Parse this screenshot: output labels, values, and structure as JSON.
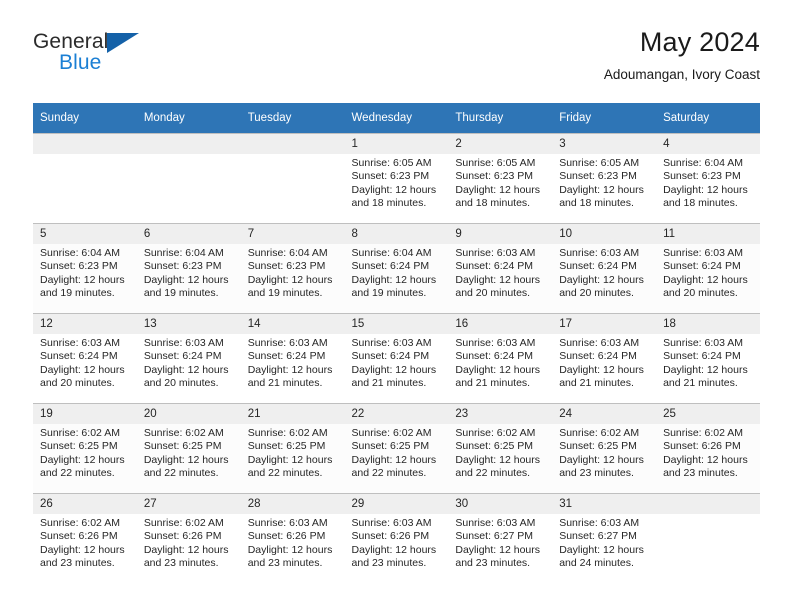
{
  "brand": {
    "word1": "General",
    "word2": "Blue",
    "triangle_color": "#1461a8",
    "blue_color": "#1b7fd4"
  },
  "header": {
    "title": "May 2024",
    "subtitle": "Adoumangan, Ivory Coast"
  },
  "theme": {
    "header_bg": "#2e75b6",
    "daynum_bg": "#efefef",
    "grid_line": "#bfbfbf",
    "text": "#262626"
  },
  "weekday_headers": [
    "Sunday",
    "Monday",
    "Tuesday",
    "Wednesday",
    "Thursday",
    "Friday",
    "Saturday"
  ],
  "weeks": [
    [
      {
        "day": "",
        "empty": true,
        "sunrise": "",
        "sunset": "",
        "daylight1": "",
        "daylight2": ""
      },
      {
        "day": "",
        "empty": true,
        "sunrise": "",
        "sunset": "",
        "daylight1": "",
        "daylight2": ""
      },
      {
        "day": "",
        "empty": true,
        "sunrise": "",
        "sunset": "",
        "daylight1": "",
        "daylight2": ""
      },
      {
        "day": "1",
        "empty": false,
        "sunrise": "Sunrise: 6:05 AM",
        "sunset": "Sunset: 6:23 PM",
        "daylight1": "Daylight: 12 hours",
        "daylight2": "and 18 minutes."
      },
      {
        "day": "2",
        "empty": false,
        "sunrise": "Sunrise: 6:05 AM",
        "sunset": "Sunset: 6:23 PM",
        "daylight1": "Daylight: 12 hours",
        "daylight2": "and 18 minutes."
      },
      {
        "day": "3",
        "empty": false,
        "sunrise": "Sunrise: 6:05 AM",
        "sunset": "Sunset: 6:23 PM",
        "daylight1": "Daylight: 12 hours",
        "daylight2": "and 18 minutes."
      },
      {
        "day": "4",
        "empty": false,
        "sunrise": "Sunrise: 6:04 AM",
        "sunset": "Sunset: 6:23 PM",
        "daylight1": "Daylight: 12 hours",
        "daylight2": "and 18 minutes."
      }
    ],
    [
      {
        "day": "5",
        "empty": false,
        "sunrise": "Sunrise: 6:04 AM",
        "sunset": "Sunset: 6:23 PM",
        "daylight1": "Daylight: 12 hours",
        "daylight2": "and 19 minutes."
      },
      {
        "day": "6",
        "empty": false,
        "sunrise": "Sunrise: 6:04 AM",
        "sunset": "Sunset: 6:23 PM",
        "daylight1": "Daylight: 12 hours",
        "daylight2": "and 19 minutes."
      },
      {
        "day": "7",
        "empty": false,
        "sunrise": "Sunrise: 6:04 AM",
        "sunset": "Sunset: 6:23 PM",
        "daylight1": "Daylight: 12 hours",
        "daylight2": "and 19 minutes."
      },
      {
        "day": "8",
        "empty": false,
        "sunrise": "Sunrise: 6:04 AM",
        "sunset": "Sunset: 6:24 PM",
        "daylight1": "Daylight: 12 hours",
        "daylight2": "and 19 minutes."
      },
      {
        "day": "9",
        "empty": false,
        "sunrise": "Sunrise: 6:03 AM",
        "sunset": "Sunset: 6:24 PM",
        "daylight1": "Daylight: 12 hours",
        "daylight2": "and 20 minutes."
      },
      {
        "day": "10",
        "empty": false,
        "sunrise": "Sunrise: 6:03 AM",
        "sunset": "Sunset: 6:24 PM",
        "daylight1": "Daylight: 12 hours",
        "daylight2": "and 20 minutes."
      },
      {
        "day": "11",
        "empty": false,
        "sunrise": "Sunrise: 6:03 AM",
        "sunset": "Sunset: 6:24 PM",
        "daylight1": "Daylight: 12 hours",
        "daylight2": "and 20 minutes."
      }
    ],
    [
      {
        "day": "12",
        "empty": false,
        "sunrise": "Sunrise: 6:03 AM",
        "sunset": "Sunset: 6:24 PM",
        "daylight1": "Daylight: 12 hours",
        "daylight2": "and 20 minutes."
      },
      {
        "day": "13",
        "empty": false,
        "sunrise": "Sunrise: 6:03 AM",
        "sunset": "Sunset: 6:24 PM",
        "daylight1": "Daylight: 12 hours",
        "daylight2": "and 20 minutes."
      },
      {
        "day": "14",
        "empty": false,
        "sunrise": "Sunrise: 6:03 AM",
        "sunset": "Sunset: 6:24 PM",
        "daylight1": "Daylight: 12 hours",
        "daylight2": "and 21 minutes."
      },
      {
        "day": "15",
        "empty": false,
        "sunrise": "Sunrise: 6:03 AM",
        "sunset": "Sunset: 6:24 PM",
        "daylight1": "Daylight: 12 hours",
        "daylight2": "and 21 minutes."
      },
      {
        "day": "16",
        "empty": false,
        "sunrise": "Sunrise: 6:03 AM",
        "sunset": "Sunset: 6:24 PM",
        "daylight1": "Daylight: 12 hours",
        "daylight2": "and 21 minutes."
      },
      {
        "day": "17",
        "empty": false,
        "sunrise": "Sunrise: 6:03 AM",
        "sunset": "Sunset: 6:24 PM",
        "daylight1": "Daylight: 12 hours",
        "daylight2": "and 21 minutes."
      },
      {
        "day": "18",
        "empty": false,
        "sunrise": "Sunrise: 6:03 AM",
        "sunset": "Sunset: 6:24 PM",
        "daylight1": "Daylight: 12 hours",
        "daylight2": "and 21 minutes."
      }
    ],
    [
      {
        "day": "19",
        "empty": false,
        "sunrise": "Sunrise: 6:02 AM",
        "sunset": "Sunset: 6:25 PM",
        "daylight1": "Daylight: 12 hours",
        "daylight2": "and 22 minutes."
      },
      {
        "day": "20",
        "empty": false,
        "sunrise": "Sunrise: 6:02 AM",
        "sunset": "Sunset: 6:25 PM",
        "daylight1": "Daylight: 12 hours",
        "daylight2": "and 22 minutes."
      },
      {
        "day": "21",
        "empty": false,
        "sunrise": "Sunrise: 6:02 AM",
        "sunset": "Sunset: 6:25 PM",
        "daylight1": "Daylight: 12 hours",
        "daylight2": "and 22 minutes."
      },
      {
        "day": "22",
        "empty": false,
        "sunrise": "Sunrise: 6:02 AM",
        "sunset": "Sunset: 6:25 PM",
        "daylight1": "Daylight: 12 hours",
        "daylight2": "and 22 minutes."
      },
      {
        "day": "23",
        "empty": false,
        "sunrise": "Sunrise: 6:02 AM",
        "sunset": "Sunset: 6:25 PM",
        "daylight1": "Daylight: 12 hours",
        "daylight2": "and 22 minutes."
      },
      {
        "day": "24",
        "empty": false,
        "sunrise": "Sunrise: 6:02 AM",
        "sunset": "Sunset: 6:25 PM",
        "daylight1": "Daylight: 12 hours",
        "daylight2": "and 23 minutes."
      },
      {
        "day": "25",
        "empty": false,
        "sunrise": "Sunrise: 6:02 AM",
        "sunset": "Sunset: 6:26 PM",
        "daylight1": "Daylight: 12 hours",
        "daylight2": "and 23 minutes."
      }
    ],
    [
      {
        "day": "26",
        "empty": false,
        "sunrise": "Sunrise: 6:02 AM",
        "sunset": "Sunset: 6:26 PM",
        "daylight1": "Daylight: 12 hours",
        "daylight2": "and 23 minutes."
      },
      {
        "day": "27",
        "empty": false,
        "sunrise": "Sunrise: 6:02 AM",
        "sunset": "Sunset: 6:26 PM",
        "daylight1": "Daylight: 12 hours",
        "daylight2": "and 23 minutes."
      },
      {
        "day": "28",
        "empty": false,
        "sunrise": "Sunrise: 6:03 AM",
        "sunset": "Sunset: 6:26 PM",
        "daylight1": "Daylight: 12 hours",
        "daylight2": "and 23 minutes."
      },
      {
        "day": "29",
        "empty": false,
        "sunrise": "Sunrise: 6:03 AM",
        "sunset": "Sunset: 6:26 PM",
        "daylight1": "Daylight: 12 hours",
        "daylight2": "and 23 minutes."
      },
      {
        "day": "30",
        "empty": false,
        "sunrise": "Sunrise: 6:03 AM",
        "sunset": "Sunset: 6:27 PM",
        "daylight1": "Daylight: 12 hours",
        "daylight2": "and 23 minutes."
      },
      {
        "day": "31",
        "empty": false,
        "sunrise": "Sunrise: 6:03 AM",
        "sunset": "Sunset: 6:27 PM",
        "daylight1": "Daylight: 12 hours",
        "daylight2": "and 24 minutes."
      },
      {
        "day": "",
        "empty": true,
        "sunrise": "",
        "sunset": "",
        "daylight1": "",
        "daylight2": ""
      }
    ]
  ]
}
